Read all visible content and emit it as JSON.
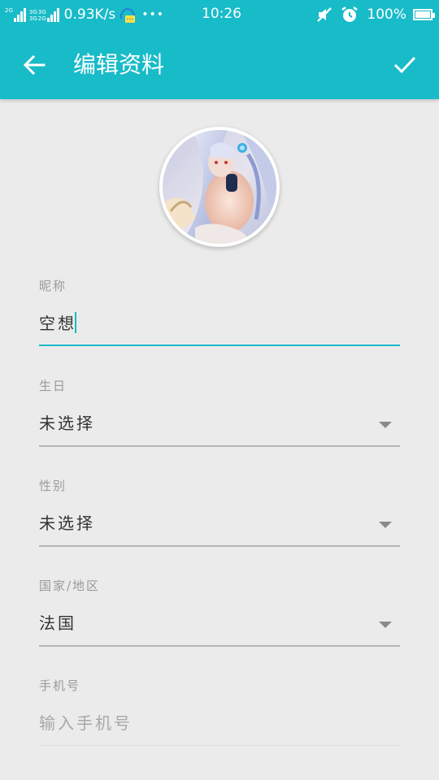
{
  "status_bar": {
    "sig1_tag": "2G",
    "sig2_tag_top": "3G",
    "sig2_tag_bot": "3G",
    "sig3_tag_top": "3G",
    "sig3_tag_bot": "2G",
    "net_speed": "0.93K/s",
    "more": "•••",
    "time": "10:26",
    "battery_pct": "100%",
    "battery_level": 1.0,
    "icons": [
      "signal-icon",
      "notification-icon",
      "mute-icon",
      "alarm-icon",
      "battery-icon"
    ]
  },
  "app_bar": {
    "title": "编辑资料",
    "back_icon": "arrow-back-icon",
    "confirm_icon": "check-icon"
  },
  "avatar": {
    "icon": "user-avatar-image"
  },
  "form": {
    "nickname": {
      "label": "昵称",
      "value": "空想"
    },
    "birthday": {
      "label": "生日",
      "value": "未选择"
    },
    "gender": {
      "label": "性别",
      "value": "未选择"
    },
    "region": {
      "label": "国家/地区",
      "value": "法国"
    },
    "phone": {
      "label": "手机号",
      "placeholder": "输入手机号"
    }
  },
  "colors": {
    "accent": "#18bbc8",
    "background": "#ebebeb",
    "label": "#9a9a9a",
    "text": "#333333"
  }
}
